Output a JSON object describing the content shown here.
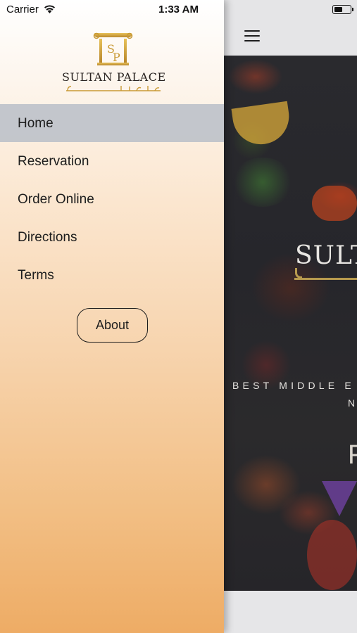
{
  "status_bar": {
    "carrier": "Carrier",
    "time": "1:33 AM",
    "icons": [
      "wifi-icon",
      "battery-icon"
    ]
  },
  "drawer": {
    "logo": {
      "monogram": "SP",
      "title": "SULTAN PALACE"
    },
    "nav_items": [
      {
        "label": "Home",
        "active": true
      },
      {
        "label": "Reservation",
        "active": false
      },
      {
        "label": "Order Online",
        "active": false
      },
      {
        "label": "Directions",
        "active": false
      },
      {
        "label": "Terms",
        "active": false
      }
    ],
    "about_button": "About",
    "colors": {
      "gradient_top": "#ffffff",
      "gradient_bottom": "#eeac65",
      "active_row": "#b9bec8"
    }
  },
  "content": {
    "menu_icon": "hamburger-menu-icon",
    "hero": {
      "logo_text": "SULTA",
      "tagline_line1": "BEST MIDDLE E",
      "tagline_line2": "N",
      "partial_letter": "F"
    }
  }
}
